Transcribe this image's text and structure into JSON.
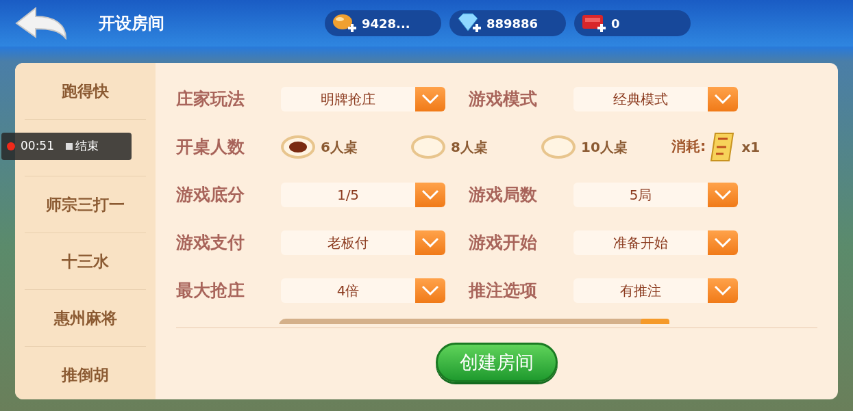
{
  "header": {
    "title": "开设房间",
    "currencies": [
      {
        "kind": "gold",
        "value": "9428..."
      },
      {
        "kind": "diamond",
        "value": "889886"
      },
      {
        "kind": "ticket",
        "value": "0"
      }
    ]
  },
  "recording": {
    "time": "00:51",
    "stop_label": "结束"
  },
  "sidebar": {
    "items": [
      {
        "kind": "tab",
        "label": "跑得快"
      },
      {
        "kind": "covered"
      },
      {
        "kind": "tab",
        "label": "师宗三打一"
      },
      {
        "kind": "tab",
        "label": "十三水"
      },
      {
        "kind": "tab",
        "label": "惠州麻将"
      },
      {
        "kind": "tab",
        "label": "推倒胡"
      }
    ]
  },
  "rows": [
    {
      "kind": "selects",
      "fields": [
        {
          "label": "庄家玩法",
          "value": "明牌抢庄"
        },
        {
          "label": "游戏模式",
          "value": "经典模式"
        }
      ]
    },
    {
      "kind": "radios",
      "label": "开桌人数",
      "options": [
        {
          "label": "6人桌",
          "selected": true
        },
        {
          "label": "8人桌",
          "selected": false
        },
        {
          "label": "10人桌",
          "selected": false
        }
      ],
      "cost_label": "消耗:",
      "cost_value": "x1"
    },
    {
      "kind": "selects",
      "fields": [
        {
          "label": "游戏底分",
          "value": "1/5"
        },
        {
          "label": "游戏局数",
          "value": "5局"
        }
      ]
    },
    {
      "kind": "selects",
      "fields": [
        {
          "label": "游戏支付",
          "value": "老板付"
        },
        {
          "label": "游戏开始",
          "value": "准备开始"
        }
      ]
    },
    {
      "kind": "selects",
      "fields": [
        {
          "label": "最大抢庄",
          "value": "4倍"
        },
        {
          "label": "推注选项",
          "value": "有推注"
        }
      ]
    },
    {
      "kind": "clipped"
    }
  ],
  "create_button": "创建房间"
}
